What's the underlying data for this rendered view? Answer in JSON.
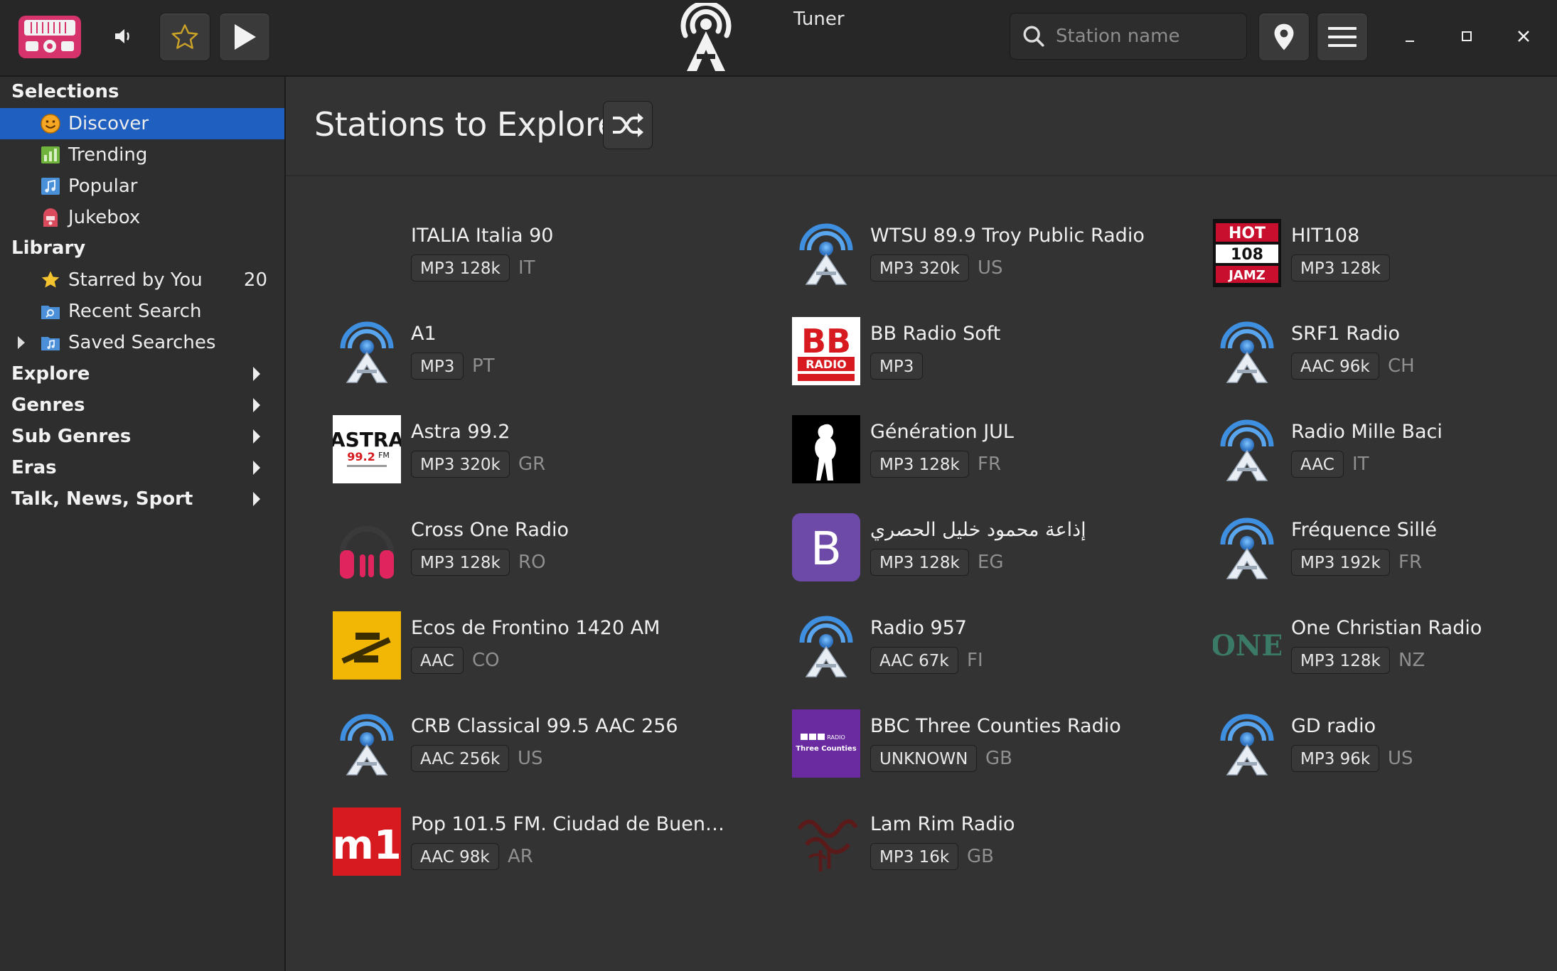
{
  "window": {
    "title": "Tuner",
    "search_placeholder": "Station name"
  },
  "sidebar": {
    "selections_heading": "Selections",
    "selections": [
      {
        "label": "Discover",
        "icon": "smiley-icon",
        "selected": true
      },
      {
        "label": "Trending",
        "icon": "chart-icon"
      },
      {
        "label": "Popular",
        "icon": "music-note-icon"
      },
      {
        "label": "Jukebox",
        "icon": "jukebox-icon"
      }
    ],
    "library_heading": "Library",
    "library": [
      {
        "label": "Starred by You",
        "icon": "star-icon",
        "count": "20"
      },
      {
        "label": "Recent Search",
        "icon": "search-folder-icon"
      },
      {
        "label": "Saved Searches",
        "icon": "music-folder-icon"
      }
    ],
    "categories": [
      "Explore",
      "Genres",
      "Sub Genres",
      "Eras",
      "Talk, News, Sport"
    ]
  },
  "main": {
    "title": "Stations to Explore",
    "stations": [
      {
        "name": "ITALIA Italia 90",
        "codec": "MP3 128k",
        "country": "IT",
        "logo": "blank"
      },
      {
        "name": "WTSU 89.9 Troy Public Radio",
        "codec": "MP3 320k",
        "country": "US",
        "logo": "default-antenna"
      },
      {
        "name": "HIT108",
        "codec": "MP3 128k",
        "country": "",
        "logo": "hot108"
      },
      {
        "name": "A1",
        "codec": "MP3",
        "country": "PT",
        "logo": "default-antenna"
      },
      {
        "name": "BB Radio Soft",
        "codec": "MP3",
        "country": "",
        "logo": "bb-radio"
      },
      {
        "name": "SRF1 Radio",
        "codec": "AAC 96k",
        "country": "CH",
        "logo": "default-antenna"
      },
      {
        "name": "Astra 99.2",
        "codec": "MP3 320k",
        "country": "GR",
        "logo": "astra"
      },
      {
        "name": "Génération JUL",
        "codec": "MP3 128k",
        "country": "FR",
        "logo": "jul"
      },
      {
        "name": "Radio Mille Baci",
        "codec": "AAC",
        "country": "IT",
        "logo": "default-antenna"
      },
      {
        "name": "Cross One Radio",
        "codec": "MP3 128k",
        "country": "RO",
        "logo": "headphones"
      },
      {
        "name": "إذاعة محمود خليل الحصري",
        "codec": "MP3 128k",
        "country": "EG",
        "logo": "letter-b"
      },
      {
        "name": "Fréquence Sillé",
        "codec": "MP3 192k",
        "country": "FR",
        "logo": "default-antenna"
      },
      {
        "name": "Ecos de Frontino 1420 AM",
        "codec": "AAC",
        "country": "CO",
        "logo": "ecos"
      },
      {
        "name": "Radio 957",
        "codec": "AAC 67k",
        "country": "FI",
        "logo": "default-antenna"
      },
      {
        "name": "One Christian Radio",
        "codec": "MP3 128k",
        "country": "NZ",
        "logo": "one"
      },
      {
        "name": "CRB Classical 99.5 AAC 256",
        "codec": "AAC 256k",
        "country": "US",
        "logo": "default-antenna"
      },
      {
        "name": "BBC Three Counties Radio",
        "codec": "UNKNOWN",
        "country": "GB",
        "logo": "bbc"
      },
      {
        "name": "GD radio",
        "codec": "MP3 96k",
        "country": "US",
        "logo": "default-antenna"
      },
      {
        "name": "Pop 101.5 FM. Ciudad de Buen…",
        "codec": "AAC 98k",
        "country": "AR",
        "logo": "m1"
      },
      {
        "name": "Lam Rim Radio",
        "codec": "MP3 16k",
        "country": "GB",
        "logo": "lamrim"
      }
    ]
  },
  "colors": {
    "accent": "#1f5fbf",
    "app_logo": "#d6336c",
    "background": "#333333"
  }
}
